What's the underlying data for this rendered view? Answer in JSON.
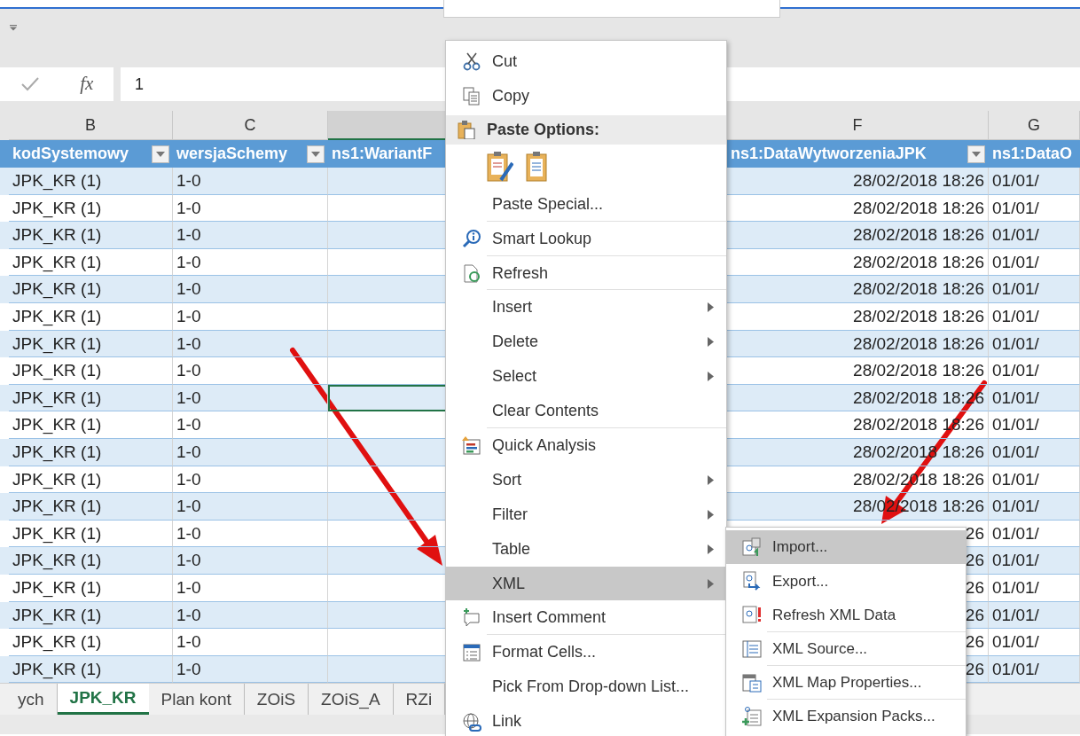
{
  "formula_bar": {
    "fx": "fx",
    "value": "1"
  },
  "columns": [
    {
      "letter": "B",
      "header": "kodSystemowy",
      "filter": true,
      "selected": false
    },
    {
      "letter": "C",
      "header": "wersjaSchemy",
      "filter": true,
      "selected": false
    },
    {
      "header": "ns1:WariantF",
      "filter": false,
      "selected": true
    },
    {
      "letter": "F",
      "header": "ns1:DataWytworzeniaJPK",
      "filter": true,
      "selected": false
    },
    {
      "letter": "G",
      "header": "ns1:DataO",
      "filter": false,
      "selected": false
    }
  ],
  "rows": [
    {
      "kod": "JPK_KR (1)",
      "wersja": "1-0",
      "data": "28/02/2018 18:26",
      "data_o": "01/01/",
      "selected": false
    },
    {
      "kod": "JPK_KR (1)",
      "wersja": "1-0",
      "data": "28/02/2018 18:26",
      "data_o": "01/01/",
      "selected": false
    },
    {
      "kod": "JPK_KR (1)",
      "wersja": "1-0",
      "data": "28/02/2018 18:26",
      "data_o": "01/01/",
      "selected": false
    },
    {
      "kod": "JPK_KR (1)",
      "wersja": "1-0",
      "data": "28/02/2018 18:26",
      "data_o": "01/01/",
      "selected": false
    },
    {
      "kod": "JPK_KR (1)",
      "wersja": "1-0",
      "data": "28/02/2018 18:26",
      "data_o": "01/01/",
      "selected": false
    },
    {
      "kod": "JPK_KR (1)",
      "wersja": "1-0",
      "data": "28/02/2018 18:26",
      "data_o": "01/01/",
      "selected": false
    },
    {
      "kod": "JPK_KR (1)",
      "wersja": "1-0",
      "data": "28/02/2018 18:26",
      "data_o": "01/01/",
      "selected": false
    },
    {
      "kod": "JPK_KR (1)",
      "wersja": "1-0",
      "data": "28/02/2018 18:26",
      "data_o": "01/01/",
      "selected": false
    },
    {
      "kod": "JPK_KR (1)",
      "wersja": "1-0",
      "data": "28/02/2018 18:26",
      "data_o": "01/01/",
      "selected": true
    },
    {
      "kod": "JPK_KR (1)",
      "wersja": "1-0",
      "data": "28/02/2018 18:26",
      "data_o": "01/01/",
      "selected": false
    },
    {
      "kod": "JPK_KR (1)",
      "wersja": "1-0",
      "data": "28/02/2018 18:26",
      "data_o": "01/01/",
      "selected": false
    },
    {
      "kod": "JPK_KR (1)",
      "wersja": "1-0",
      "data": "28/02/2018 18:26",
      "data_o": "01/01/",
      "selected": false
    },
    {
      "kod": "JPK_KR (1)",
      "wersja": "1-0",
      "data": "28/02/2018 18:26",
      "data_o": "01/01/",
      "selected": false
    },
    {
      "kod": "JPK_KR (1)",
      "wersja": "1-0",
      "data": "26",
      "data_o": "01/01/",
      "selected": false
    },
    {
      "kod": "JPK_KR (1)",
      "wersja": "1-0",
      "data": "26",
      "data_o": "01/01/",
      "selected": false
    },
    {
      "kod": "JPK_KR (1)",
      "wersja": "1-0",
      "data": "26",
      "data_o": "01/01/",
      "selected": false
    },
    {
      "kod": "JPK_KR (1)",
      "wersja": "1-0",
      "data": "26",
      "data_o": "01/01/",
      "selected": false
    },
    {
      "kod": "JPK_KR (1)",
      "wersja": "1-0",
      "data": "26",
      "data_o": "01/01/",
      "selected": false
    },
    {
      "kod": "JPK_KR (1)",
      "wersja": "1-0",
      "data": "26",
      "data_o": "01/01/",
      "selected": false
    }
  ],
  "sheet_tabs": [
    {
      "label": "ych",
      "selected": false
    },
    {
      "label": "JPK_KR",
      "selected": true
    },
    {
      "label": "Plan kont",
      "selected": false
    },
    {
      "label": "ZOiS",
      "selected": false
    },
    {
      "label": "ZOiS_A",
      "selected": false
    },
    {
      "label": "RZi",
      "selected": false
    }
  ],
  "context_menu": [
    {
      "kind": "item",
      "label": "Cut",
      "submenu": false,
      "selected": false,
      "separator": false
    },
    {
      "kind": "item",
      "label": "Copy",
      "submenu": false,
      "selected": false,
      "separator": false
    },
    {
      "kind": "header",
      "label": "Paste Options:"
    },
    {
      "kind": "paste_icons"
    },
    {
      "kind": "item",
      "label": "Paste Special...",
      "submenu": false,
      "selected": false,
      "separator": true
    },
    {
      "kind": "item",
      "label": "Smart Lookup",
      "submenu": false,
      "selected": false,
      "separator": true
    },
    {
      "kind": "item",
      "label": "Refresh",
      "submenu": false,
      "selected": false,
      "separator": true
    },
    {
      "kind": "item",
      "label": "Insert",
      "submenu": true,
      "selected": false,
      "separator": false
    },
    {
      "kind": "item",
      "label": "Delete",
      "submenu": true,
      "selected": false,
      "separator": false
    },
    {
      "kind": "item",
      "label": "Select",
      "submenu": true,
      "selected": false,
      "separator": false
    },
    {
      "kind": "item",
      "label": "Clear Contents",
      "submenu": false,
      "selected": false,
      "separator": true
    },
    {
      "kind": "item",
      "label": "Quick Analysis",
      "submenu": false,
      "selected": false,
      "separator": false
    },
    {
      "kind": "item",
      "label": "Sort",
      "submenu": true,
      "selected": false,
      "separator": false
    },
    {
      "kind": "item",
      "label": "Filter",
      "submenu": true,
      "selected": false,
      "separator": false
    },
    {
      "kind": "item",
      "label": "Table",
      "submenu": true,
      "selected": false,
      "separator": false
    },
    {
      "kind": "item",
      "label": "XML",
      "submenu": true,
      "selected": true,
      "separator": false
    },
    {
      "kind": "item",
      "label": "Insert Comment",
      "submenu": false,
      "selected": false,
      "separator": true
    },
    {
      "kind": "item",
      "label": "Format Cells...",
      "submenu": false,
      "selected": false,
      "separator": false
    },
    {
      "kind": "item",
      "label": "Pick From Drop-down List...",
      "submenu": false,
      "selected": false,
      "separator": false
    },
    {
      "kind": "item",
      "label": "Link",
      "submenu": false,
      "selected": false
    }
  ],
  "xml_submenu": [
    {
      "label": "Import...",
      "selected": true,
      "separator": false
    },
    {
      "label": "Export...",
      "selected": false,
      "separator": false
    },
    {
      "label": "Refresh XML Data",
      "selected": false,
      "separator": true
    },
    {
      "label": "XML Source...",
      "selected": false,
      "separator": true
    },
    {
      "label": "XML Map Properties...",
      "selected": false,
      "separator": true
    },
    {
      "label": "XML Expansion Packs...",
      "selected": false,
      "separator": false
    }
  ]
}
